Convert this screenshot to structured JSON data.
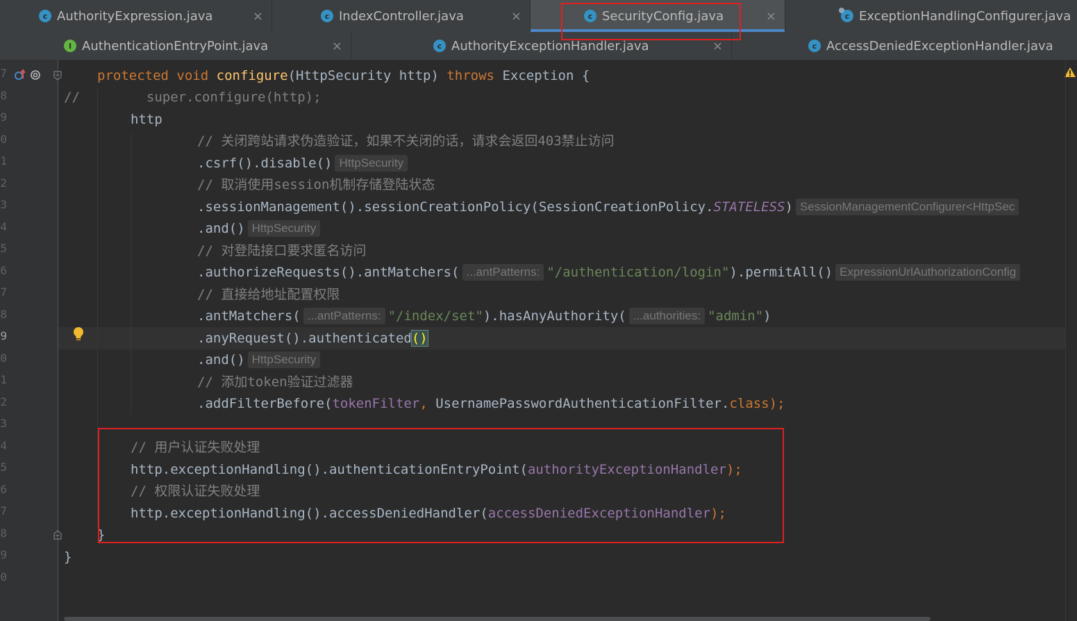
{
  "tabs_row1": [
    {
      "label": "AuthorityExpression.java",
      "icon": "class-icon"
    },
    {
      "label": "IndexController.java",
      "icon": "class-icon"
    },
    {
      "label": "SecurityConfig.java",
      "icon": "class-icon",
      "active": true
    },
    {
      "label": "ExceptionHandlingConfigurer.java",
      "icon": "class-lib-icon"
    }
  ],
  "tabs_row2": [
    {
      "label": "AuthenticationEntryPoint.java",
      "icon": "interface-icon"
    },
    {
      "label": "AuthorityExceptionHandler.java",
      "icon": "class-icon"
    },
    {
      "label": "AccessDeniedExceptionHandler.java",
      "icon": "class-icon"
    }
  ],
  "icon_letters": {
    "class": "c",
    "interface": "I"
  },
  "close_glyph": "×",
  "line_numbers": [
    "7",
    "8",
    "9",
    "0",
    "1",
    "2",
    "3",
    "4",
    "5",
    "6",
    "7",
    "8",
    "9",
    "0",
    "1",
    "2",
    "3",
    "4",
    "5",
    "6",
    "7",
    "8",
    "9",
    "0"
  ],
  "code": {
    "l1": {
      "a": "protected",
      "b": "void",
      "c": "configure",
      "d": "(HttpSecurity http) ",
      "e": "throws",
      "f": " Exception {"
    },
    "l2": {
      "a": "//",
      "b": "super.configure(http);"
    },
    "l3": {
      "a": "http"
    },
    "l4": {
      "a": "// 关闭跨站请求伪造验证，如果不关闭的话，请求会返回403禁止访问"
    },
    "l5": {
      "a": ".csrf().disable()",
      "hint": "HttpSecurity"
    },
    "l6": {
      "a": "// 取消使用session机制存储登陆状态"
    },
    "l7": {
      "a": ".sessionManagement().sessionCreationPolicy(SessionCreationPolicy.",
      "b": "STATELESS",
      "c": ")",
      "hint": "SessionManagementConfigurer<HttpSec"
    },
    "l8": {
      "a": ".and()",
      "hint": "HttpSecurity"
    },
    "l9": {
      "a": "// 对登陆接口要求匿名访问"
    },
    "l10": {
      "a": ".authorizeRequests().antMatchers(",
      "hint": "...antPatterns:",
      "b": "\"/authentication/login\"",
      "c": ").permitAll()",
      "hint2": "ExpressionUrlAuthorizationConfig"
    },
    "l11": {
      "a": "// 直接给地址配置权限"
    },
    "l12": {
      "a": ".antMatchers(",
      "hint": "...antPatterns:",
      "b": "\"/index/set\"",
      "c": ").hasAnyAuthority(",
      "hint2": "...authorities:",
      "d": "\"admin\"",
      "e": ")"
    },
    "l13": {
      "a": ".anyRequest().authenticated",
      "b": "()"
    },
    "l14": {
      "a": ".and()",
      "hint": "HttpSecurity"
    },
    "l15": {
      "a": "// 添加token验证过滤器"
    },
    "l16": {
      "a": ".addFilterBefore(",
      "b": "tokenFilter",
      "c": ", ",
      "d": "UsernamePasswordAuthenticationFilter.",
      "e": "class",
      "f": ");"
    },
    "l18": {
      "a": "// 用户认证失败处理"
    },
    "l19": {
      "a": "http.exceptionHandling().authenticationEntryPoint(",
      "b": "authorityExceptionHandler",
      "c": ");"
    },
    "l20": {
      "a": "// 权限认证失败处理"
    },
    "l21": {
      "a": "http.exceptionHandling().accessDeniedHandler(",
      "b": "accessDeniedExceptionHandler",
      "c": ");"
    },
    "l22": {
      "a": "}"
    },
    "l23": {
      "a": "}"
    }
  },
  "colors": {
    "keyword": "#cc7832",
    "method": "#ffc66d",
    "string": "#6a8759",
    "comment": "#808080",
    "field": "#9876aa",
    "text": "#a9b7c6",
    "highlight_box": "#e02020",
    "tab_underline": "#4a88c7"
  }
}
